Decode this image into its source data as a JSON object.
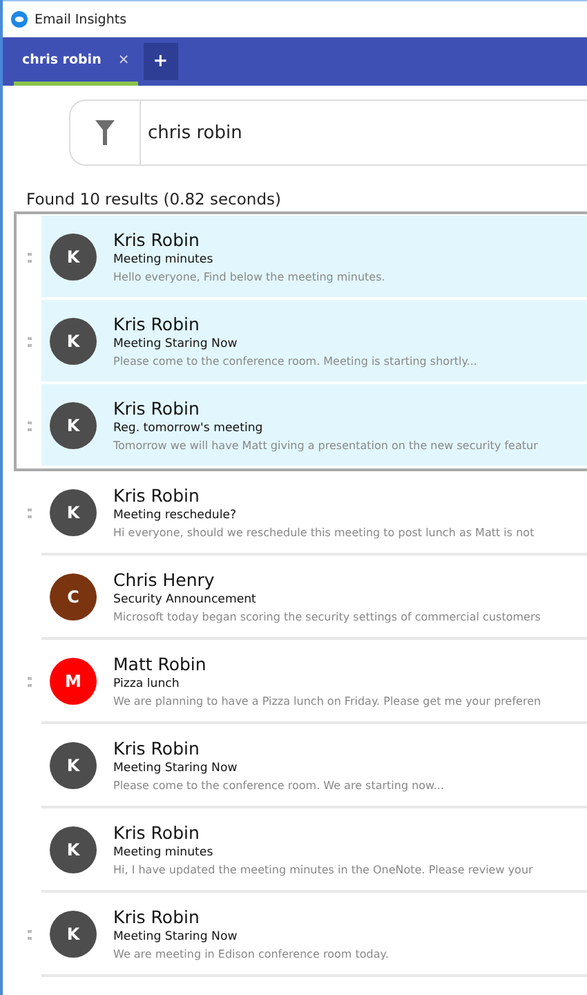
{
  "window": {
    "title": "Email Insights"
  },
  "tabs": [
    {
      "label": "chris robin",
      "selected": true,
      "close": "×"
    }
  ],
  "new_tab": "+",
  "search": {
    "value": "chris robin"
  },
  "results_summary": "Found 10 results (0.82 seconds)",
  "results": [
    {
      "sender": "Kris Robin",
      "initial": "K",
      "color": "#4d4d4d",
      "subject": "Meeting minutes",
      "preview": "Hello everyone, Find below the meeting minutes.",
      "selected": true,
      "marked": true
    },
    {
      "sender": "Kris Robin",
      "initial": "K",
      "color": "#4d4d4d",
      "subject": "Meeting Staring Now",
      "preview": "Please come to the conference room. Meeting is starting shortly...",
      "selected": true,
      "marked": true
    },
    {
      "sender": "Kris Robin",
      "initial": "K",
      "color": "#4d4d4d",
      "subject": "Reg. tomorrow's meeting",
      "preview": "Tomorrow we will have Matt giving a presentation on the new security featur",
      "selected": true,
      "marked": true
    },
    {
      "sender": "Kris Robin",
      "initial": "K",
      "color": "#4d4d4d",
      "subject": "Meeting reschedule?",
      "preview": "Hi everyone, should we reschedule this meeting to post lunch as Matt is not",
      "selected": false,
      "marked": true
    },
    {
      "sender": "Chris Henry",
      "initial": "C",
      "color": "#7a3410",
      "subject": "Security Announcement",
      "preview": "Microsoft today began scoring the security settings of commercial customers",
      "selected": false,
      "marked": false
    },
    {
      "sender": "Matt Robin",
      "initial": "M",
      "color": "#ff0000",
      "subject": "Pizza lunch",
      "preview": "We are planning to have a Pizza lunch on Friday. Please get me your preferen",
      "selected": false,
      "marked": true
    },
    {
      "sender": "Kris Robin",
      "initial": "K",
      "color": "#4d4d4d",
      "subject": "Meeting Staring Now",
      "preview": "Please come to the conference room. We are starting now...",
      "selected": false,
      "marked": false
    },
    {
      "sender": "Kris Robin",
      "initial": "K",
      "color": "#4d4d4d",
      "subject": "Meeting minutes",
      "preview": "Hi, I have updated the meeting minutes in the OneNote. Please review your",
      "selected": false,
      "marked": false
    },
    {
      "sender": "Kris Robin",
      "initial": "K",
      "color": "#4d4d4d",
      "subject": "Meeting Staring Now",
      "preview": "We are meeting in Edison conference room today.",
      "selected": false,
      "marked": true
    }
  ]
}
